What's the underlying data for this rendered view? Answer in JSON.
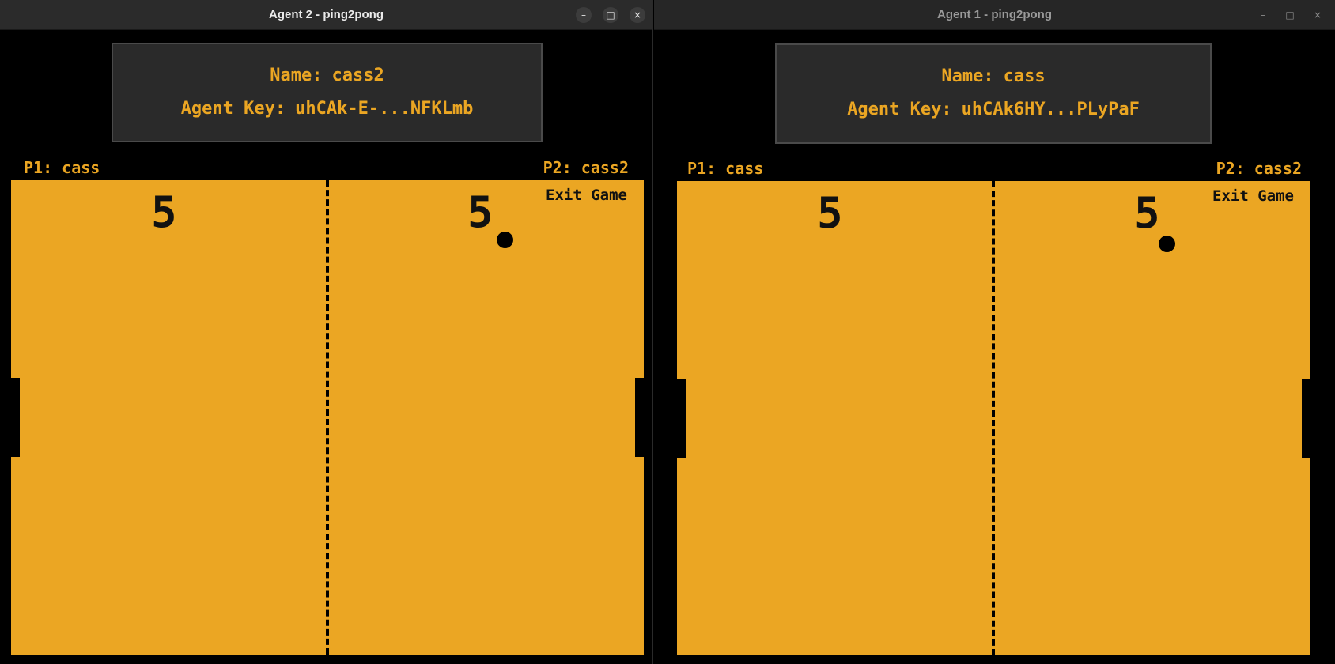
{
  "colors": {
    "field": "#eba623",
    "accent_text": "#eba623",
    "panel": "#2a2a2a",
    "background": "#000000"
  },
  "windows": [
    {
      "title": "Agent 2 - ping2pong",
      "active": true,
      "controls": {
        "minimize": "–",
        "maximize": "□",
        "close": "×"
      },
      "info": {
        "name_label": "Name:",
        "name_value": "cass2",
        "key_label": "Agent Key:",
        "key_value": "uhCAk-E-...NFKLmb"
      },
      "p1_tag": "P1: cass",
      "p2_tag": "P2: cass2",
      "score_left": "5",
      "score_right": "5",
      "exit_label": "Exit Game"
    },
    {
      "title": "Agent 1 - ping2pong",
      "active": false,
      "controls": {
        "minimize": "–",
        "maximize": "□",
        "close": "×"
      },
      "info": {
        "name_label": "Name:",
        "name_value": "cass",
        "key_label": "Agent Key:",
        "key_value": "uhCAk6HY...PLyPaF"
      },
      "p1_tag": "P1: cass",
      "p2_tag": "P2: cass2",
      "score_left": "5",
      "score_right": "5",
      "exit_label": "Exit Game"
    }
  ]
}
